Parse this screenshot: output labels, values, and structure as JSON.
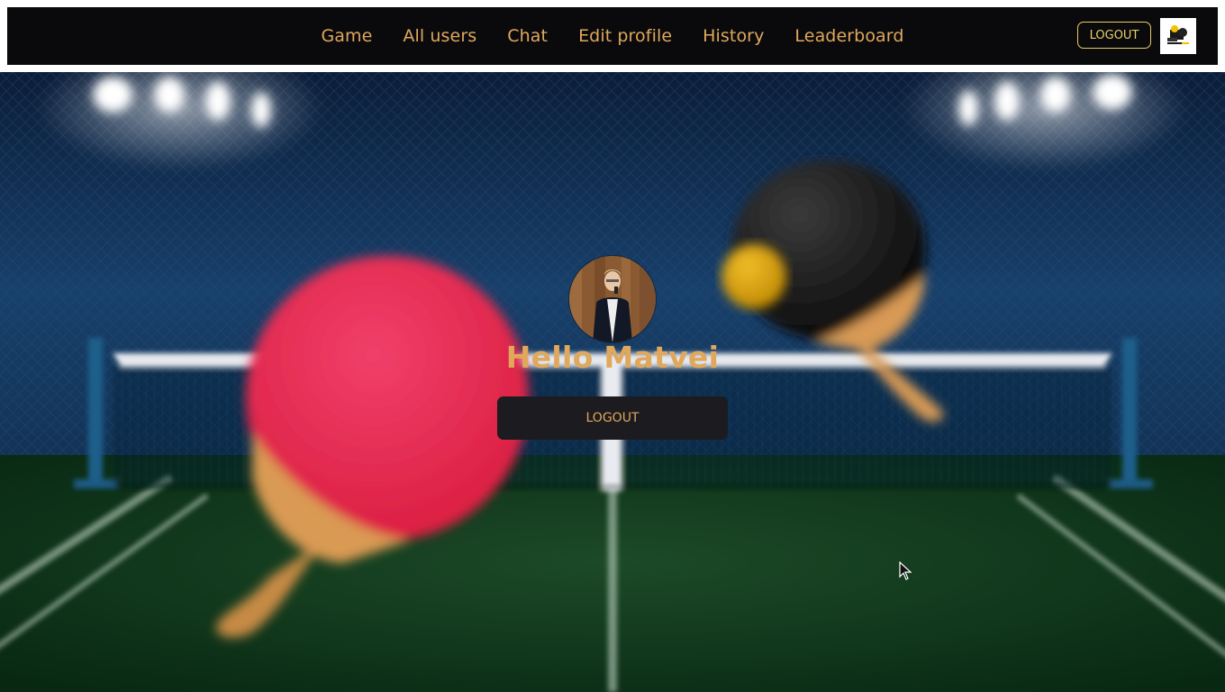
{
  "nav": {
    "links": [
      "Game",
      "All users",
      "Chat",
      "Edit profile",
      "History",
      "Leaderboard"
    ],
    "logout_label": "LOGOUT",
    "logo_icon": "ping-pong-logo-icon"
  },
  "main": {
    "greeting": "Hello Matvei",
    "logout_label": "LOGOUT",
    "avatar_icon": "user-avatar"
  },
  "colors": {
    "nav_background": "#0a0a0c",
    "accent": "#e0a85c",
    "logout_border": "#e9cc5f",
    "button_background": "#1c1b1f"
  }
}
